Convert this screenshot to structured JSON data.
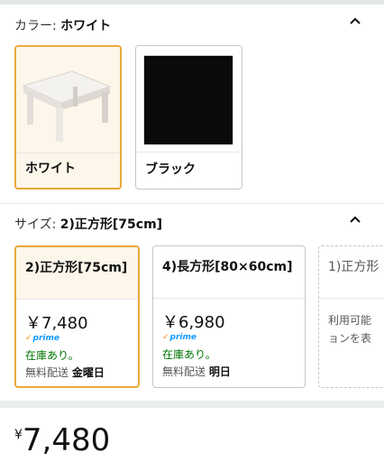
{
  "color_section": {
    "label": "カラー:",
    "selected_value": "ホワイト",
    "options": [
      {
        "name": "ホワイト",
        "selected": true
      },
      {
        "name": "ブラック",
        "selected": false
      }
    ],
    "collapse_icon": "chevron-up-icon"
  },
  "size_section": {
    "label": "サイズ:",
    "selected_value": "2)正方形[75cm]",
    "collapse_icon": "chevron-up-icon",
    "options": [
      {
        "title": "2)正方形[75cm]",
        "price": "￥7,480",
        "prime": "prime",
        "stock": "在庫あり。",
        "ship_label": "無料配送",
        "ship_day": "金曜日",
        "selected": true
      },
      {
        "title": "4)長方形[80×60cm]",
        "price": "￥6,980",
        "prime": "prime",
        "stock": "在庫あり。",
        "ship_label": "無料配送",
        "ship_day": "明日",
        "selected": false
      },
      {
        "title": "1)正方形",
        "unavailable_line1": "利用可能",
        "unavailable_line2": "ョンを表",
        "selected": false
      }
    ]
  },
  "price": {
    "currency": "¥",
    "amount": "7,480"
  },
  "colors": {
    "accent": "#e8a93a",
    "selected_bg": "#fdf6ea",
    "in_stock": "#007600",
    "prime": "#1399ff"
  }
}
